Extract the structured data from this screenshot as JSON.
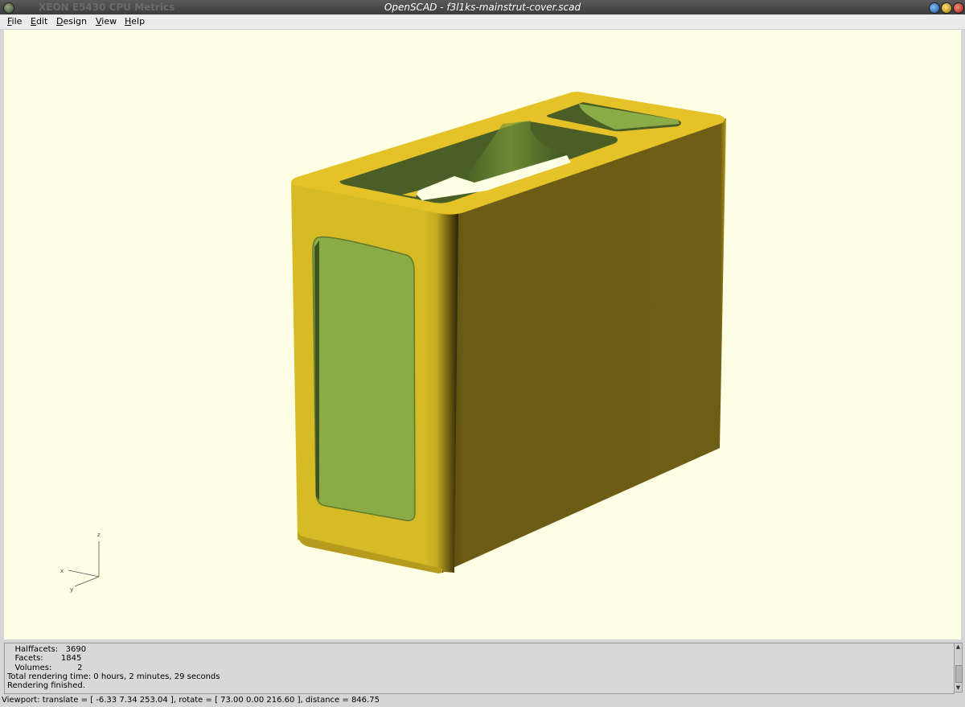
{
  "window": {
    "background_app_title": "XEON E5430 CPU Metrics",
    "title": "OpenSCAD - f3l1ks-mainstrut-cover.scad"
  },
  "menu": {
    "items": [
      "File",
      "Edit",
      "Design",
      "View",
      "Help"
    ]
  },
  "axes": {
    "x": "x",
    "y": "y",
    "z": "z"
  },
  "console": {
    "lines": [
      "   Halffacets:   3690",
      "   Facets:       1845",
      "   Volumes:          2",
      "Total rendering time: 0 hours, 2 minutes, 29 seconds",
      "Rendering finished."
    ]
  },
  "status": {
    "viewport": "Viewport: translate = [ -6.33 7.34 253.04 ], rotate = [ 73.00 0.00 216.60 ], distance = 846.75"
  },
  "colors": {
    "viewport_bg": "#ffffe5",
    "model_top": "#e4c228",
    "model_side_dark": "#6e5d14",
    "model_side_light": "#d6ba26",
    "cutout_green": "#8aab45"
  },
  "icons": [
    "window-menu-icon",
    "minimize-icon",
    "maximize-icon",
    "close-icon"
  ]
}
